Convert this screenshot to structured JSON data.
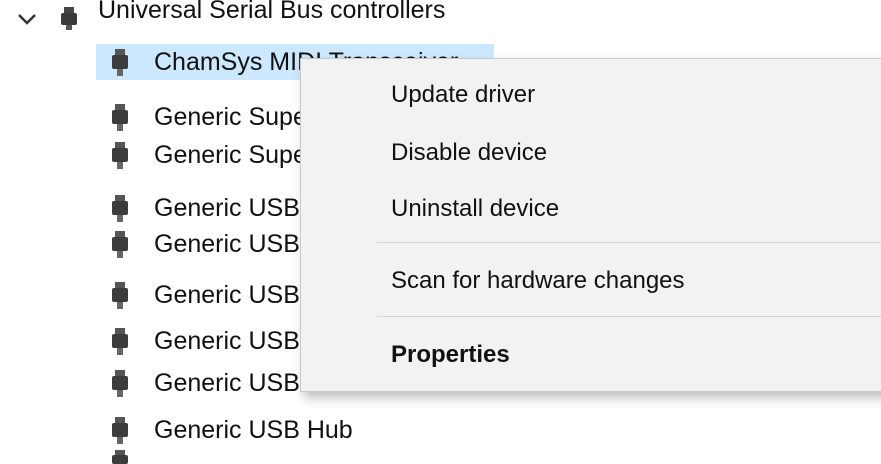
{
  "tree": {
    "category": {
      "label": "Universal Serial Bus controllers",
      "icon": "usb-plug-icon",
      "expand_icon": "chevron-down-icon"
    },
    "devices": [
      {
        "label": "ChamSys MIDI Transceiver",
        "icon": "usb-plug-icon",
        "selected": true
      },
      {
        "label": "Generic SuperSpeed USB Hub",
        "icon": "usb-plug-icon"
      },
      {
        "label": "Generic SuperSpeed USB Hub",
        "icon": "usb-plug-icon"
      },
      {
        "label": "Generic USB Hub",
        "icon": "usb-plug-icon"
      },
      {
        "label": "Generic USB Hub",
        "icon": "usb-plug-icon"
      },
      {
        "label": "Generic USB Hub",
        "icon": "usb-plug-icon"
      },
      {
        "label": "Generic USB Hub",
        "icon": "usb-plug-icon"
      },
      {
        "label": "Generic USB Hub",
        "icon": "usb-plug-icon"
      },
      {
        "label": "Generic USB Hub",
        "icon": "usb-plug-icon"
      }
    ]
  },
  "context_menu": {
    "items": [
      {
        "label": "Update driver"
      },
      {
        "label": "Disable device"
      },
      {
        "label": "Uninstall device"
      },
      {
        "label": "Scan for hardware changes"
      },
      {
        "label": "Properties",
        "bold": true
      }
    ]
  },
  "colors": {
    "selection": "#cce8ff",
    "menu_background": "#f2f2f2",
    "menu_separator": "#d4d4d4",
    "text": "#111111"
  }
}
